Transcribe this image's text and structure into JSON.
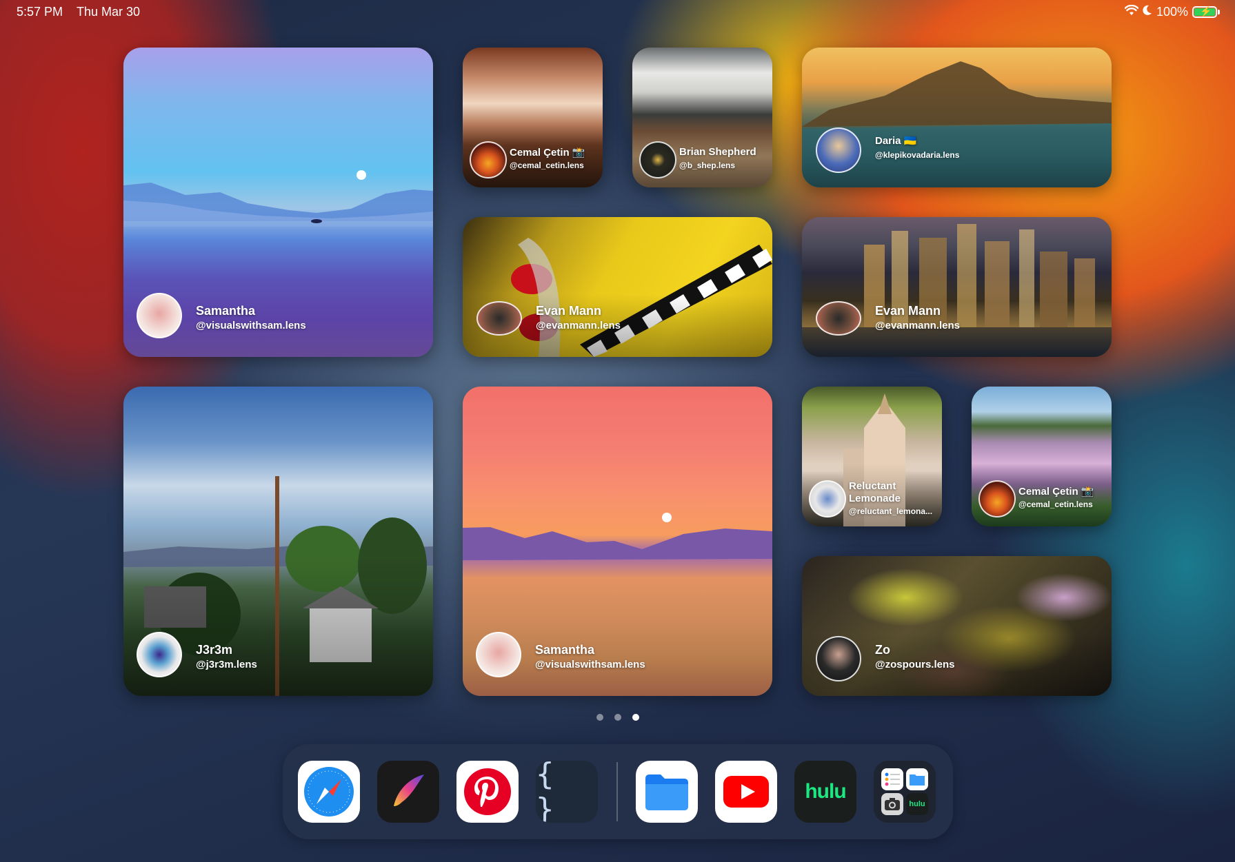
{
  "status_bar": {
    "time": "5:57 PM",
    "date": "Thu Mar 30",
    "battery_percent": "100%",
    "battery_level": 1.0,
    "icons": [
      "wifi-icon",
      "moon-icon",
      "battery-charging-icon"
    ]
  },
  "widgets": [
    {
      "id": "samantha-1",
      "name": "Samantha",
      "handle": "@visualswithsam.lens"
    },
    {
      "id": "cemal-1",
      "name": "Cemal Çetin 📸",
      "handle": "@cemal_cetin.lens"
    },
    {
      "id": "brian",
      "name": "Brian Shepherd",
      "handle": "@b_shep.lens"
    },
    {
      "id": "daria",
      "name": "Daria 🇺🇦",
      "handle": "@klepikovadaria.lens"
    },
    {
      "id": "evan-1",
      "name": "Evan Mann",
      "handle": "@evanmann.lens"
    },
    {
      "id": "evan-2",
      "name": "Evan Mann",
      "handle": "@evanmann.lens"
    },
    {
      "id": "j3r3m",
      "name": "J3r3m",
      "handle": "@j3r3m.lens"
    },
    {
      "id": "samantha-2",
      "name": "Samantha",
      "handle": "@visualswithsam.lens"
    },
    {
      "id": "reluctant",
      "name": "Reluctant Lemonade",
      "handle": "@reluctant_lemona..."
    },
    {
      "id": "cemal-2",
      "name": "Cemal Çetin 📸",
      "handle": "@cemal_cetin.lens"
    },
    {
      "id": "zo",
      "name": "Zo",
      "handle": "@zospours.lens"
    }
  ],
  "page_dots": {
    "count": 3,
    "active_index": 2
  },
  "dock": {
    "apps": [
      "Safari",
      "Procreate",
      "Pinterest",
      "Scriptable",
      "Files",
      "YouTube",
      "Hulu",
      "App Library"
    ],
    "hulu_label": "hulu",
    "scriptable_label": "{ }",
    "folder_hulu_label": "hulu"
  }
}
